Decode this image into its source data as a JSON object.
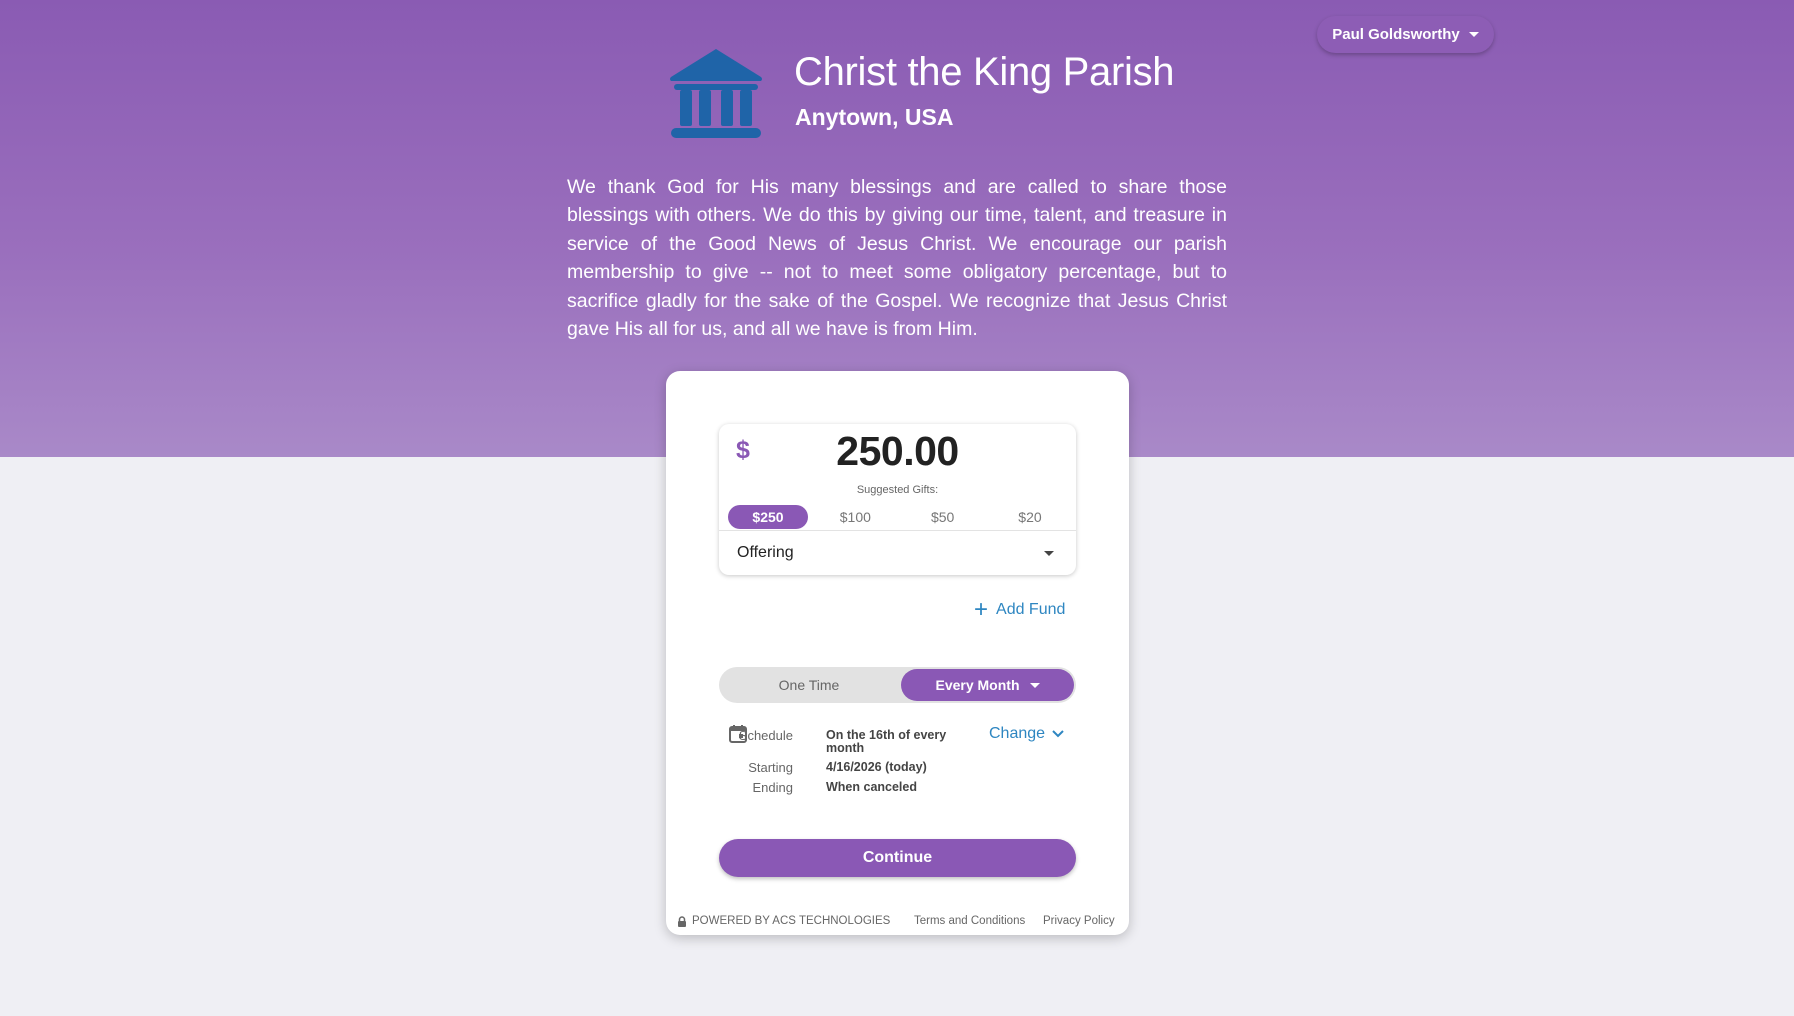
{
  "colors": {
    "brand_purple": "#8a58b5",
    "link_blue": "#2e86c1",
    "icon_blue": "#1f64a8"
  },
  "header": {
    "user_name": "Paul Goldsworthy",
    "parish_icon": "bank-building-icon",
    "parish_name": "Christ the King Parish",
    "parish_location": "Anytown, USA",
    "mission_text": "We thank God for His many blessings and are called to share those blessings with others. We do this by giving our time, talent, and treasure in service of the Good News of Jesus Christ. We encourage our parish membership to give -- not to meet some obligatory percentage, but to sacrifice gladly for the sake of the Gospel. We recognize that Jesus Christ gave His all for us, and all we have is from Him."
  },
  "gift": {
    "currency_symbol": "$",
    "amount": "250.00",
    "suggested_label": "Suggested Gifts:",
    "suggestions": [
      "$250",
      "$100",
      "$50",
      "$20"
    ],
    "selected_suggestion": "$250",
    "fund": "Offering",
    "add_fund_label": "Add Fund"
  },
  "frequency": {
    "one_time_label": "One Time",
    "selected_label": "Every Month"
  },
  "schedule": {
    "schedule_label": "Schedule",
    "schedule_value": "On the 16th of every month",
    "starting_label": "Starting",
    "starting_value": "4/16/2026 (today)",
    "ending_label": "Ending",
    "ending_value": "When canceled",
    "change_label": "Change"
  },
  "actions": {
    "continue_label": "Continue"
  },
  "footer": {
    "powered_by": "POWERED BY ACS TECHNOLOGIES",
    "terms": "Terms and Conditions",
    "privacy": "Privacy Policy"
  }
}
